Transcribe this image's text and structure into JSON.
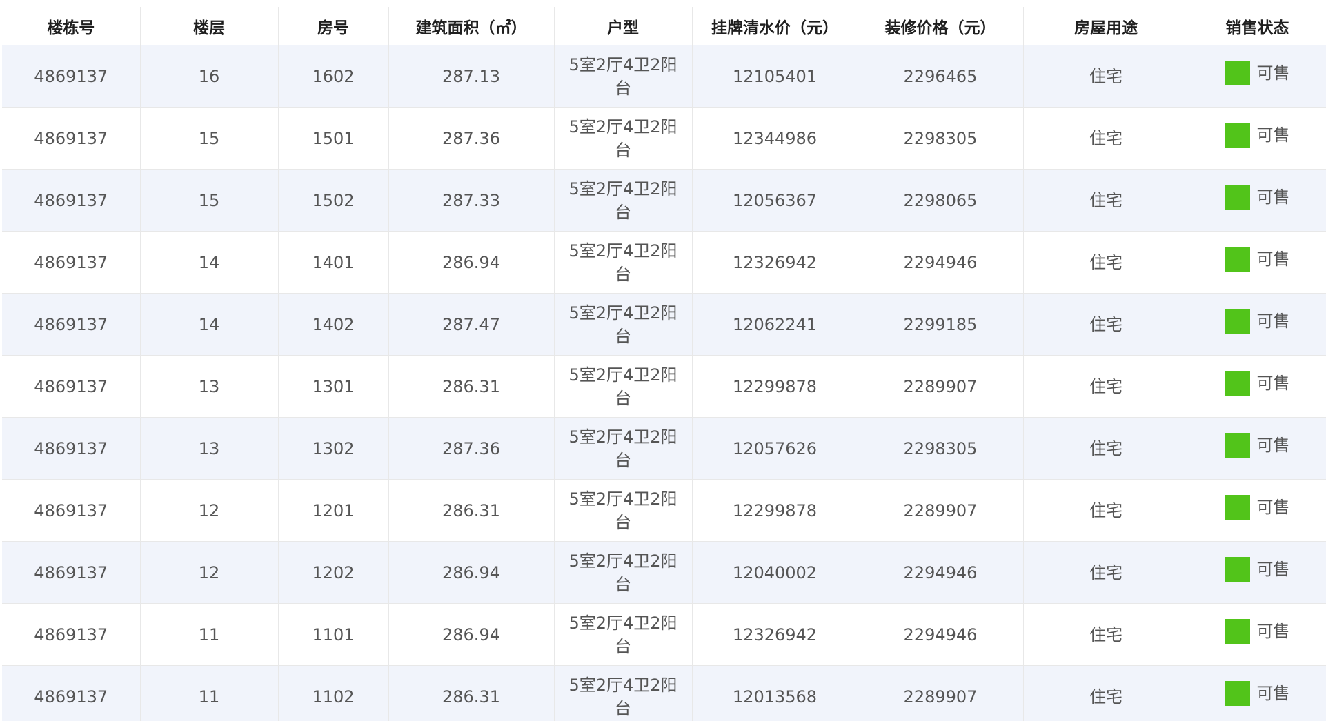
{
  "table": {
    "headers": [
      "楼栋号",
      "楼层",
      "房号",
      "建筑面积（㎡）",
      "户型",
      "挂牌清水价（元）",
      "装修价格（元）",
      "房屋用途",
      "销售状态"
    ],
    "status_color": "#52c41a",
    "rows": [
      {
        "building": "4869137",
        "floor": "16",
        "room": "1602",
        "area": "287.13",
        "layout": "5室2厅4卫2阳台",
        "list_price": "12105401",
        "decoration_price": "2296465",
        "usage": "住宅",
        "status": "可售"
      },
      {
        "building": "4869137",
        "floor": "15",
        "room": "1501",
        "area": "287.36",
        "layout": "5室2厅4卫2阳台",
        "list_price": "12344986",
        "decoration_price": "2298305",
        "usage": "住宅",
        "status": "可售"
      },
      {
        "building": "4869137",
        "floor": "15",
        "room": "1502",
        "area": "287.33",
        "layout": "5室2厅4卫2阳台",
        "list_price": "12056367",
        "decoration_price": "2298065",
        "usage": "住宅",
        "status": "可售"
      },
      {
        "building": "4869137",
        "floor": "14",
        "room": "1401",
        "area": "286.94",
        "layout": "5室2厅4卫2阳台",
        "list_price": "12326942",
        "decoration_price": "2294946",
        "usage": "住宅",
        "status": "可售"
      },
      {
        "building": "4869137",
        "floor": "14",
        "room": "1402",
        "area": "287.47",
        "layout": "5室2厅4卫2阳台",
        "list_price": "12062241",
        "decoration_price": "2299185",
        "usage": "住宅",
        "status": "可售"
      },
      {
        "building": "4869137",
        "floor": "13",
        "room": "1301",
        "area": "286.31",
        "layout": "5室2厅4卫2阳台",
        "list_price": "12299878",
        "decoration_price": "2289907",
        "usage": "住宅",
        "status": "可售"
      },
      {
        "building": "4869137",
        "floor": "13",
        "room": "1302",
        "area": "287.36",
        "layout": "5室2厅4卫2阳台",
        "list_price": "12057626",
        "decoration_price": "2298305",
        "usage": "住宅",
        "status": "可售"
      },
      {
        "building": "4869137",
        "floor": "12",
        "room": "1201",
        "area": "286.31",
        "layout": "5室2厅4卫2阳台",
        "list_price": "12299878",
        "decoration_price": "2289907",
        "usage": "住宅",
        "status": "可售"
      },
      {
        "building": "4869137",
        "floor": "12",
        "room": "1202",
        "area": "286.94",
        "layout": "5室2厅4卫2阳台",
        "list_price": "12040002",
        "decoration_price": "2294946",
        "usage": "住宅",
        "status": "可售"
      },
      {
        "building": "4869137",
        "floor": "11",
        "room": "1101",
        "area": "286.94",
        "layout": "5室2厅4卫2阳台",
        "list_price": "12326942",
        "decoration_price": "2294946",
        "usage": "住宅",
        "status": "可售"
      },
      {
        "building": "4869137",
        "floor": "11",
        "room": "1102",
        "area": "286.31",
        "layout": "5室2厅4卫2阳台",
        "list_price": "12013568",
        "decoration_price": "2289907",
        "usage": "住宅",
        "status": "可售"
      }
    ]
  }
}
